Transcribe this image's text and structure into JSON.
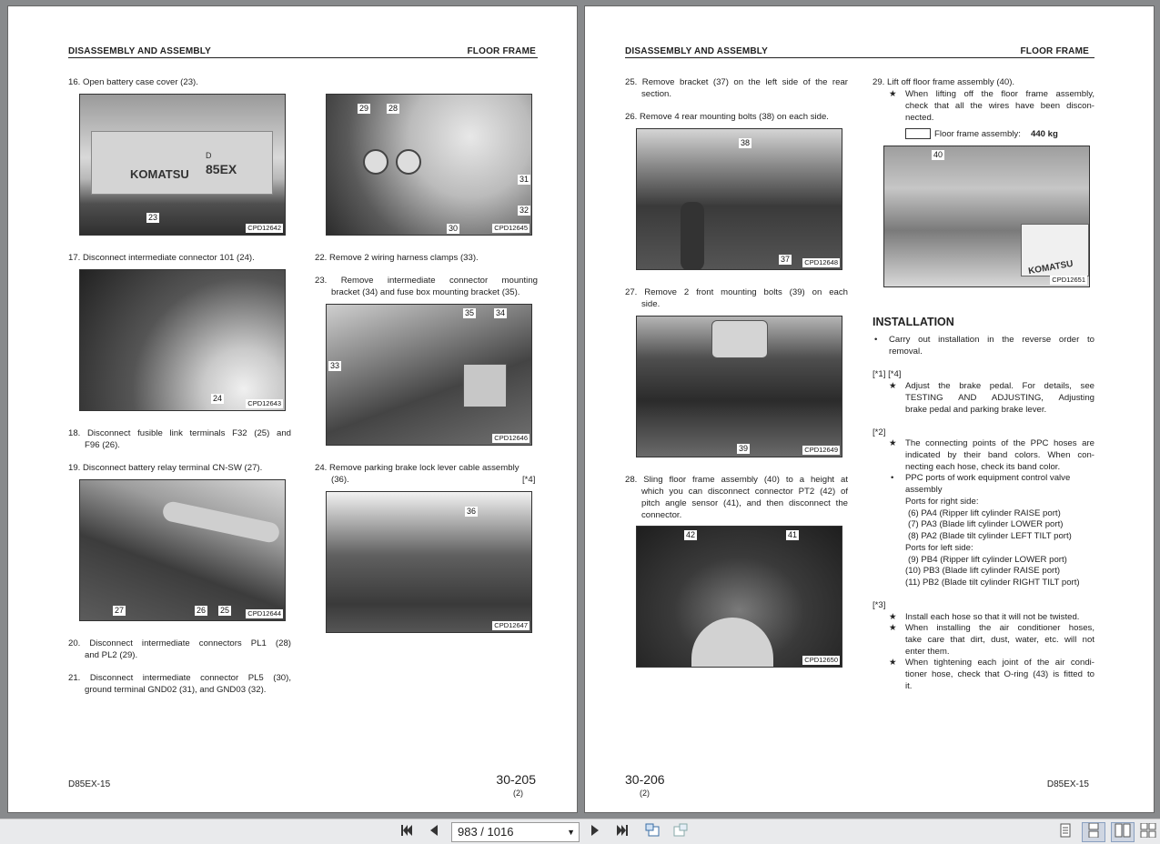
{
  "pages": [
    {
      "header_left": "DISASSEMBLY AND ASSEMBLY",
      "header_right": "FLOOR FRAME",
      "steps": {
        "s16": "16. Open battery case cover (23).",
        "s17": "17. Disconnect intermediate connector 101 (24).",
        "s18a": "18. Disconnect fusible link terminals F32 (25) and",
        "s18b": "F96 (26).",
        "s19": "19. Disconnect battery relay terminal CN-SW (27).",
        "s20a": "20. Disconnect intermediate connectors PL1 (28)",
        "s20b": "and PL2 (29).",
        "s21a": "21. Disconnect intermediate connector PL5 (30),",
        "s21b": "ground terminal GND02 (31), and GND03 (32).",
        "s22": "22. Remove 2 wiring harness clamps (33).",
        "s23a": "23. Remove intermediate connector mounting",
        "s23b": "bracket (34) and fuse box mounting bracket (35).",
        "s24a": "24. Remove parking brake lock lever cable assembly",
        "s24b": "(36).",
        "s24ref": "[*4]"
      },
      "photos": {
        "p1": {
          "caption": "CPD12642",
          "callouts": [
            "23"
          ],
          "brand": "KOMATSU",
          "model": "85EX",
          "model_prefix": "D"
        },
        "p2": {
          "caption": "CPD12645",
          "callouts": [
            "29",
            "28",
            "31",
            "32",
            "30"
          ]
        },
        "p3": {
          "caption": "CPD12643",
          "callouts": [
            "24"
          ]
        },
        "p4": {
          "caption": "CPD12646",
          "callouts": [
            "35",
            "34",
            "33"
          ]
        },
        "p5": {
          "caption": "CPD12644",
          "callouts": [
            "27",
            "26",
            "25"
          ]
        },
        "p6": {
          "caption": "CPD12647",
          "callouts": [
            "36"
          ]
        }
      },
      "footer_model": "D85EX-15",
      "page_number": "30-205",
      "page_sub": "(2)"
    },
    {
      "header_left": "DISASSEMBLY AND ASSEMBLY",
      "header_right": "FLOOR FRAME",
      "steps": {
        "s25a": "25. Remove bracket (37) on the left side of the rear",
        "s25b": "section.",
        "s26": "26. Remove 4 rear mounting bolts (38) on each side.",
        "s27a": "27. Remove 2 front mounting bolts (39) on each",
        "s27b": "side.",
        "s28a": "28. Sling floor frame assembly (40) to a height at",
        "s28b": "which you can disconnect connector PT2 (42) of",
        "s28c": "pitch angle sensor (41), and then disconnect the",
        "s28d": "connector.",
        "s29": "29. Lift off floor frame assembly (40).",
        "s29n1": "When lifting off the floor frame assembly,",
        "s29n2": "check that all the wires have been discon-",
        "s29n3": "nected.",
        "weight_label": "Floor frame assembly:",
        "weight_value": "440 kg"
      },
      "photos": {
        "p1": {
          "caption": "CPD12648",
          "callouts": [
            "38",
            "37"
          ]
        },
        "p2": {
          "caption": "CPD12649",
          "callouts": [
            "39"
          ]
        },
        "p3": {
          "caption": "CPD12650",
          "callouts": [
            "42",
            "41"
          ]
        },
        "p4": {
          "caption": "CPD12651",
          "callouts": [
            "40"
          ],
          "brand": "KOMATSU"
        }
      },
      "installation": {
        "title": "INSTALLATION",
        "intro1": "Carry out installation in the reverse order to",
        "intro2": "removal.",
        "ref1": "[*1] [*4]",
        "r1a": "Adjust the brake pedal.  For details, see",
        "r1b": "TESTING AND ADJUSTING, Adjusting",
        "r1c": "brake pedal and parking brake lever.",
        "ref2": "[*2]",
        "r2a": "The connecting points of the PPC hoses are",
        "r2b": "indicated by their band colors.  When con-",
        "r2c": "necting each hose, check its band color.",
        "r2d": "PPC ports of work equipment control valve",
        "r2e": "assembly",
        "r2f": "Ports for right side:",
        "port1": "(6)  PA4 (Ripper lift cylinder RAISE port)",
        "port2": "(7)  PA3 (Blade lift cylinder LOWER port)",
        "port3": "(8)  PA2 (Blade tilt cylinder LEFT TILT port)",
        "r2g": "Ports for left side:",
        "port4": "(9)  PB4 (Ripper lift cylinder LOWER port)",
        "port5": "(10) PB3 (Blade lift cylinder RAISE port)",
        "port6": "(11) PB2 (Blade tilt cylinder RIGHT TILT port)",
        "ref3": "[*3]",
        "r3a": "Install each hose so that it will not be twisted.",
        "r3b": "When installing the air conditioner hoses,",
        "r3c": "take care that dirt, dust, water, etc. will not",
        "r3d": "enter them.",
        "r3e": "When tightening each joint of the air condi-",
        "r3f": "tioner hose, check that O-ring (43) is fitted to",
        "r3g": "it."
      },
      "footer_model": "D85EX-15",
      "page_number": "30-206",
      "page_sub": "(2)"
    }
  ],
  "glyphs": {
    "star": "★",
    "bullet": "•"
  },
  "toolbar": {
    "page_field": "983 / 1016",
    "icons": [
      "first-page-icon",
      "prev-page-icon",
      "next-page-icon",
      "last-page-icon",
      "rotate-left-icon",
      "rotate-right-icon",
      "single-page-view-icon",
      "continuous-view-icon",
      "two-page-view-icon",
      "two-page-continuous-view-icon"
    ]
  }
}
